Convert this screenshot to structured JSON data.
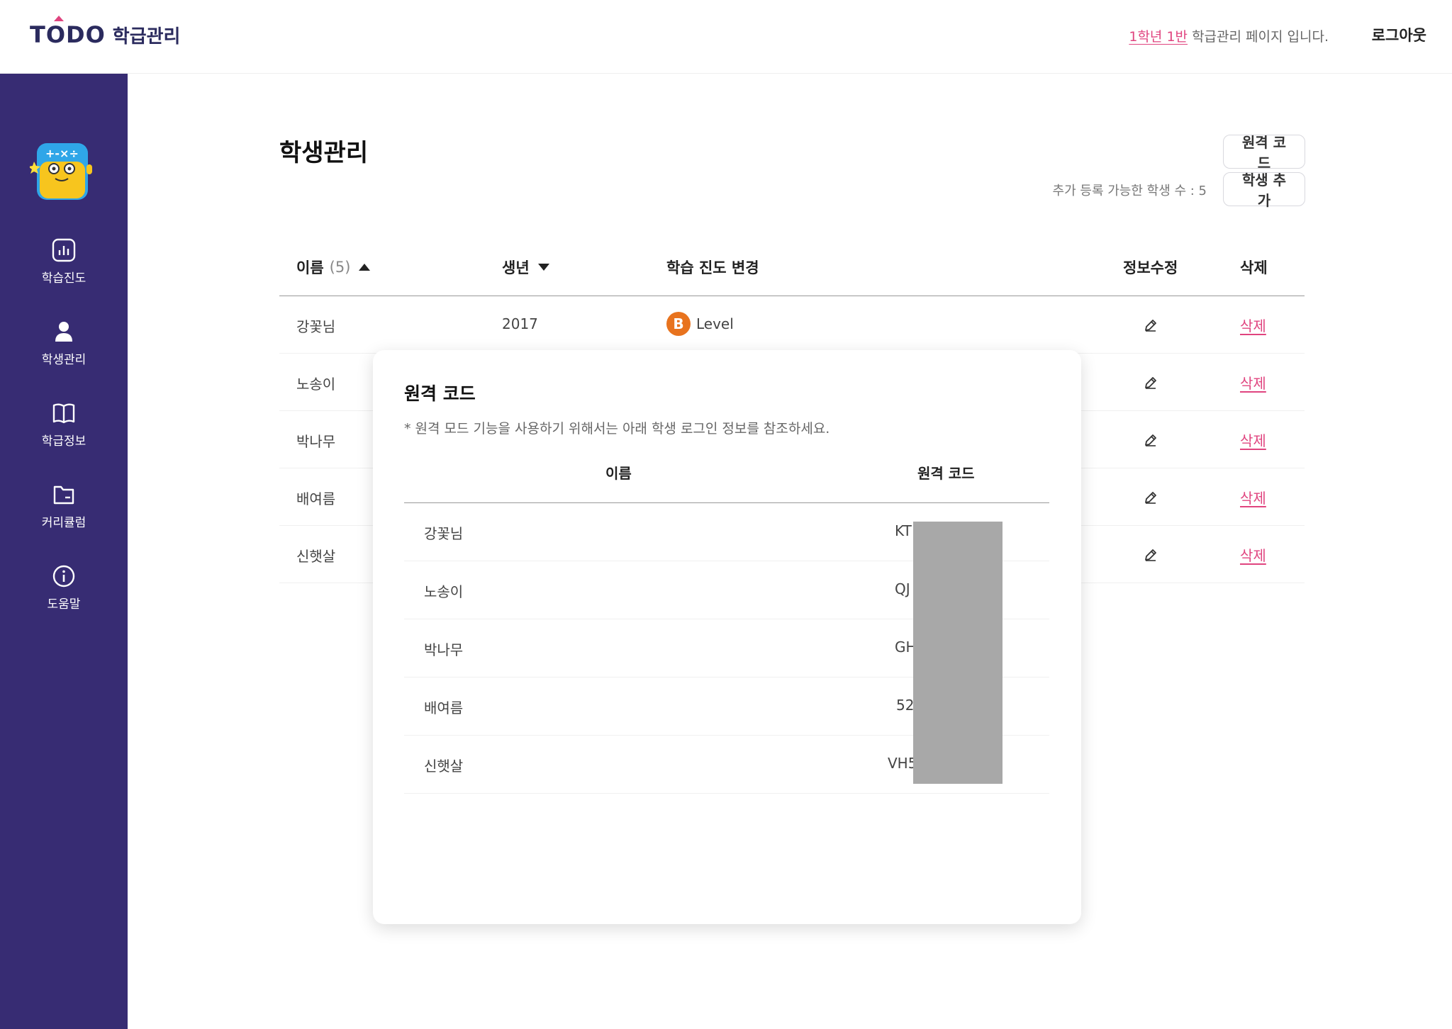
{
  "header": {
    "logo_main": "TODO",
    "logo_sub": "학급관리",
    "class_highlight": "1학년 1반",
    "class_suffix": " 학급관리 페이지 입니다.",
    "logout_label": "로그아웃"
  },
  "sidebar": {
    "items": [
      {
        "label": "학습진도",
        "icon": "chart-icon"
      },
      {
        "label": "학생관리",
        "icon": "user-icon"
      },
      {
        "label": "학급정보",
        "icon": "book-icon"
      },
      {
        "label": "커리큘럼",
        "icon": "folder-icon"
      },
      {
        "label": "도움말",
        "icon": "info-icon"
      }
    ]
  },
  "main": {
    "title": "학생관리",
    "remote_code_button": "원격 코드",
    "add_student_button": "학생 추가",
    "available_text": "추가 등록 가능한 학생 수 : 5"
  },
  "table": {
    "headers": {
      "name": "이름",
      "count": "(5)",
      "year": "생년",
      "progress": "학습 진도 변경",
      "edit": "정보수정",
      "delete": "삭제"
    },
    "rows": [
      {
        "name": "강꽃님",
        "year": "2017",
        "level_badge": "B",
        "level_label": "Level",
        "delete": "삭제"
      },
      {
        "name": "노송이",
        "delete": "삭제"
      },
      {
        "name": "박나무",
        "delete": "삭제"
      },
      {
        "name": "배여름",
        "delete": "삭제"
      },
      {
        "name": "신햇살",
        "delete": "삭제"
      }
    ]
  },
  "modal": {
    "title": "원격 코드",
    "note": "* 원격 모드 기능을 사용하기 위해서는 아래 학생 로그인 정보를 참조하세요.",
    "headers": {
      "name": "이름",
      "code": "원격 코드"
    },
    "rows": [
      {
        "name": "강꽃님",
        "code": "KT"
      },
      {
        "name": "노송이",
        "code": "QJ"
      },
      {
        "name": "박나무",
        "code": "GH"
      },
      {
        "name": "배여름",
        "code": "52"
      },
      {
        "name": "신햇살",
        "code": "VH5"
      }
    ]
  },
  "colors": {
    "sidebar": "#372c73",
    "accent": "#e0447f",
    "level_badge": "#e8731e",
    "redaction": "#a8a8a8"
  }
}
